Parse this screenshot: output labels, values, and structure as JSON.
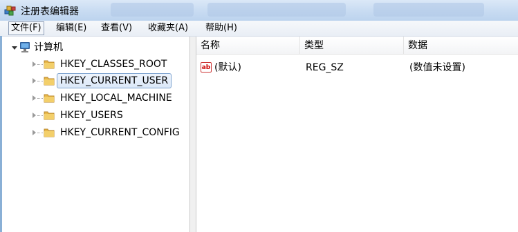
{
  "window": {
    "title": "注册表编辑器",
    "icon": "regedit-icon"
  },
  "menu": [
    {
      "label": "文件(F)",
      "active": true
    },
    {
      "label": "编辑(E)"
    },
    {
      "label": "查看(V)"
    },
    {
      "label": "收藏夹(A)"
    },
    {
      "label": "帮助(H)"
    }
  ],
  "tree": {
    "root": {
      "label": "计算机",
      "icon": "computer-icon"
    },
    "items": [
      {
        "label": "HKEY_CLASSES_ROOT",
        "icon": "folder-icon"
      },
      {
        "label": "HKEY_CURRENT_USER",
        "icon": "folder-icon",
        "selected": true
      },
      {
        "label": "HKEY_LOCAL_MACHINE",
        "icon": "folder-icon"
      },
      {
        "label": "HKEY_USERS",
        "icon": "folder-icon"
      },
      {
        "label": "HKEY_CURRENT_CONFIG",
        "icon": "folder-icon"
      }
    ]
  },
  "list": {
    "columns": [
      "名称",
      "类型",
      "数据"
    ],
    "rows": [
      {
        "name": "(默认)",
        "type": "REG_SZ",
        "data": "(数值未设置)",
        "icon": "string-value-icon"
      }
    ]
  },
  "colors": {
    "selection_border": "#7da2ce",
    "titlebar": "#c9dcf2",
    "folder": "#e8b84a"
  }
}
